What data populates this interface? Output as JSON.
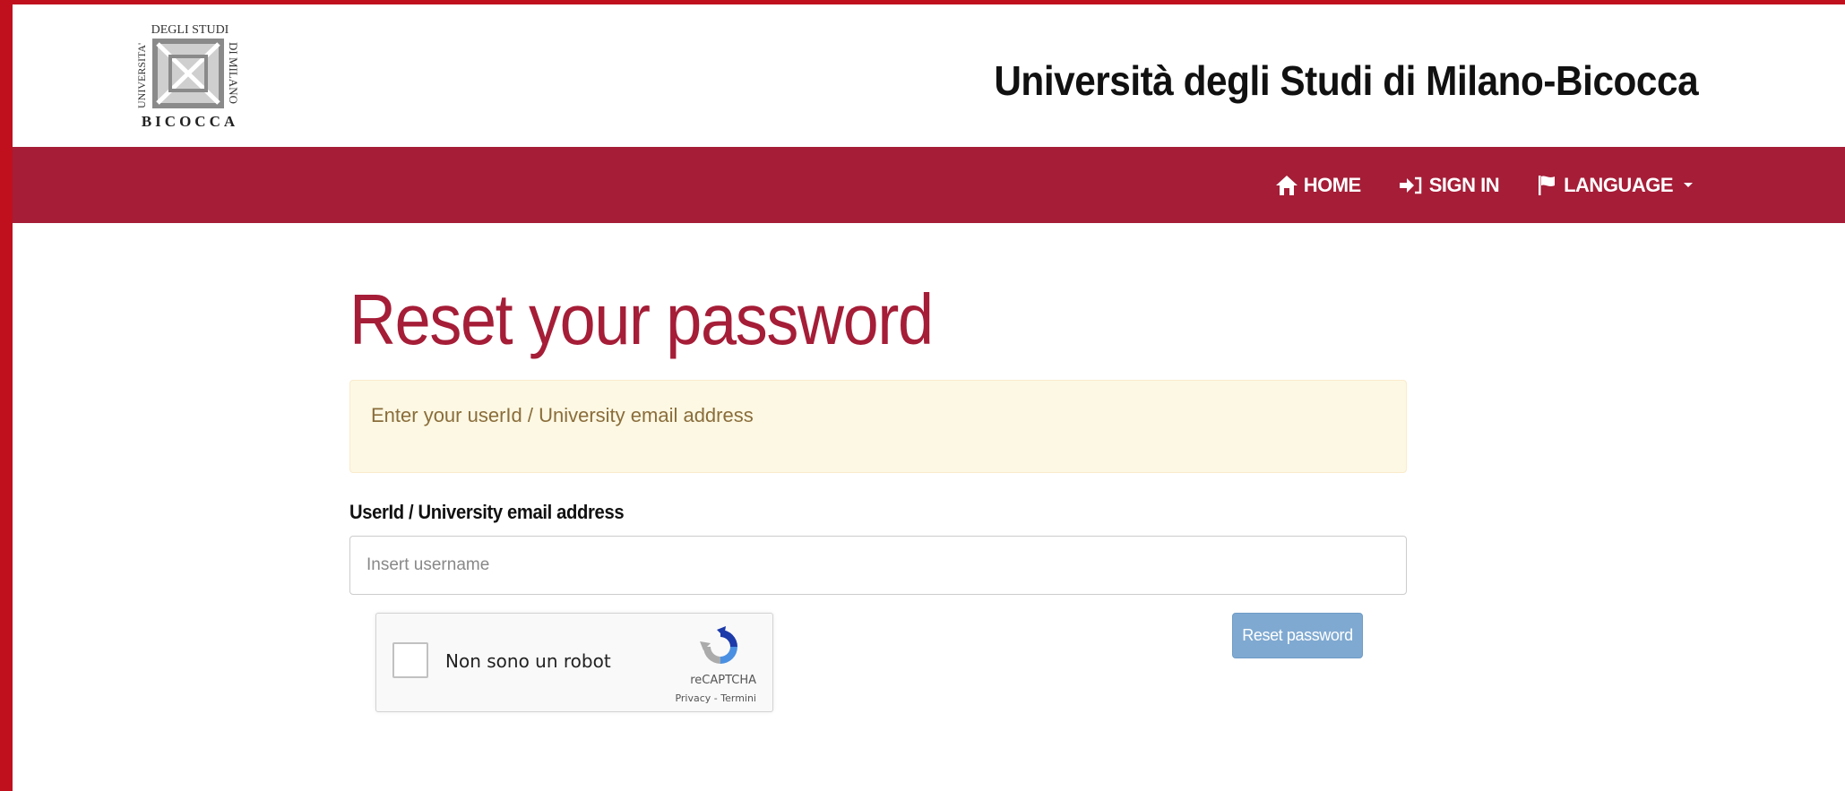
{
  "header": {
    "logo": {
      "top_text": "DEGLI STUDI",
      "left_text": "UNIVERSITA'",
      "right_text": "DI MILANO",
      "bottom_text": "BICOCCA"
    },
    "site_title": "Università degli Studi di Milano-Bicocca"
  },
  "nav": {
    "items": [
      {
        "label": "HOME",
        "icon": "home-icon"
      },
      {
        "label": "SIGN IN",
        "icon": "sign-in-icon"
      },
      {
        "label": "LANGUAGE",
        "icon": "flag-icon"
      }
    ]
  },
  "main": {
    "title": "Reset your password",
    "alert": "Enter your userId / University email address",
    "field_label": "UserId / University email address",
    "input_placeholder": "Insert username",
    "input_value": "",
    "submit_label": "Reset password"
  },
  "recaptcha": {
    "label": "Non sono un robot",
    "brand": "reCAPTCHA",
    "links": "Privacy - Termini"
  },
  "colors": {
    "brand": "#a51d37",
    "frame": "#c0101e",
    "alert_bg": "#fcf8e3",
    "button": "#7fa9d1"
  }
}
